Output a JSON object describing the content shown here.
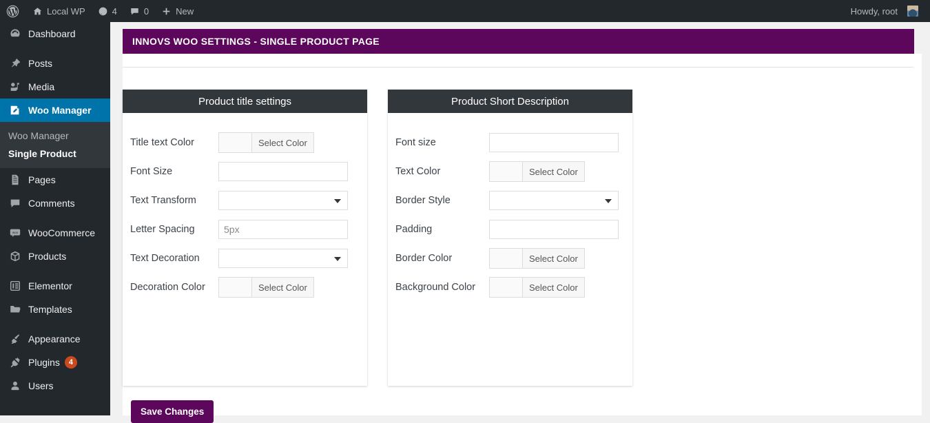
{
  "adminbar": {
    "logo_icon": "wordpress-logo-icon",
    "site": {
      "label": "Local WP",
      "icon": "home-icon"
    },
    "updates": {
      "count": "4",
      "icon": "updates-icon"
    },
    "comments": {
      "count": "0",
      "icon": "comment-bubble-icon"
    },
    "new": {
      "label": "New",
      "icon": "plus-icon"
    },
    "howdy": "Howdy, root"
  },
  "sidebar": {
    "items": [
      {
        "label": "Dashboard",
        "icon": "dashboard-icon",
        "current": false
      },
      {
        "label": "Posts",
        "icon": "pin-icon",
        "current": false
      },
      {
        "label": "Media",
        "icon": "media-icon",
        "current": false
      },
      {
        "label": "Woo Manager",
        "icon": "post-edit-icon",
        "current": true
      },
      {
        "label": "Pages",
        "icon": "pages-icon",
        "current": false
      },
      {
        "label": "Comments",
        "icon": "comment-bubble-icon",
        "current": false
      },
      {
        "label": "WooCommerce",
        "icon": "woocommerce-icon",
        "current": false
      },
      {
        "label": "Products",
        "icon": "products-box-icon",
        "current": false
      },
      {
        "label": "Elementor",
        "icon": "elementor-icon",
        "current": false
      },
      {
        "label": "Templates",
        "icon": "folder-icon",
        "current": false
      },
      {
        "label": "Appearance",
        "icon": "paintbrush-icon",
        "current": false
      },
      {
        "label": "Plugins",
        "icon": "plug-icon",
        "current": false,
        "badge": "4"
      },
      {
        "label": "Users",
        "icon": "user-icon",
        "current": false
      }
    ],
    "submenu": [
      {
        "label": "Woo Manager",
        "current": false
      },
      {
        "label": "Single Product",
        "current": true
      }
    ]
  },
  "banner": {
    "title": "INNOVS WOO SETTINGS - SINGLE PRODUCT PAGE",
    "color": "#5c065c"
  },
  "panels": [
    {
      "title": "Product title settings",
      "rows": [
        {
          "label": "Title text Color",
          "type": "color",
          "button": "Select Color",
          "swatch": ""
        },
        {
          "label": "Font Size",
          "type": "text",
          "value": "",
          "placeholder": ""
        },
        {
          "label": "Text Transform",
          "type": "select",
          "value": ""
        },
        {
          "label": "Letter Spacing",
          "type": "text",
          "value": "",
          "placeholder": "5px"
        },
        {
          "label": "Text Decoration",
          "type": "select",
          "value": ""
        },
        {
          "label": "Decoration Color",
          "type": "color",
          "button": "Select Color",
          "swatch": ""
        }
      ]
    },
    {
      "title": "Product Short Description",
      "rows": [
        {
          "label": "Font size",
          "type": "text",
          "value": "",
          "placeholder": ""
        },
        {
          "label": "Text Color",
          "type": "color",
          "button": "Select Color",
          "swatch": ""
        },
        {
          "label": "Border Style",
          "type": "select",
          "value": ""
        },
        {
          "label": "Padding",
          "type": "text",
          "value": "",
          "placeholder": ""
        },
        {
          "label": "Border Color",
          "type": "color",
          "button": "Select Color",
          "swatch": ""
        },
        {
          "label": "Background Color",
          "type": "color",
          "button": "Select Color",
          "swatch": ""
        }
      ]
    }
  ],
  "save_button": "Save Changes"
}
